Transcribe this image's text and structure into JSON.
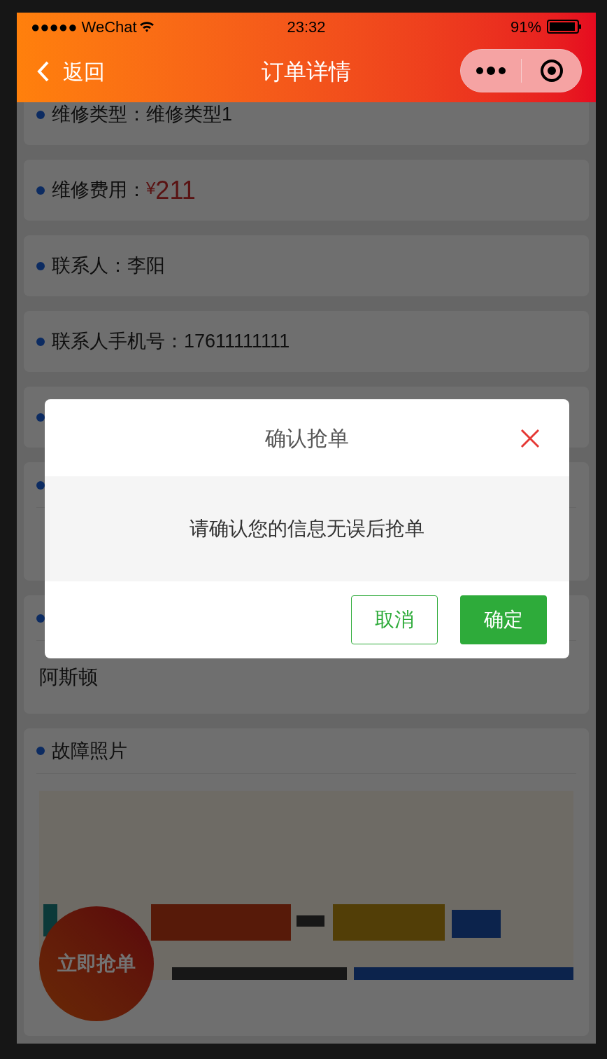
{
  "status_bar": {
    "carrier": "●●●●● WeChat",
    "time": "23:32",
    "battery": "91%"
  },
  "nav": {
    "back": "返回",
    "title": "订单详情"
  },
  "cards": [
    {
      "kind": "inline",
      "label": "维修类型：",
      "value": "维修类型1"
    },
    {
      "kind": "price",
      "label": "维修费用：",
      "currency": "¥",
      "amount": "211"
    },
    {
      "kind": "inline",
      "label": "联系人：",
      "value": "李阳"
    },
    {
      "kind": "inline",
      "label": "联系人手机号：",
      "value": "17611111111"
    },
    {
      "kind": "inline"
    },
    {
      "kind": "stacked"
    },
    {
      "kind": "stacked",
      "value": "阿斯顿"
    },
    {
      "label": "故障照片"
    }
  ],
  "float_button": "立即抢单",
  "dialog": {
    "title": "确认抢单",
    "message": "请确认您的信息无误后抢单",
    "buttons": [
      {
        "label": "取消",
        "kind": "outline"
      },
      {
        "label": "确定",
        "kind": "primary"
      }
    ]
  }
}
